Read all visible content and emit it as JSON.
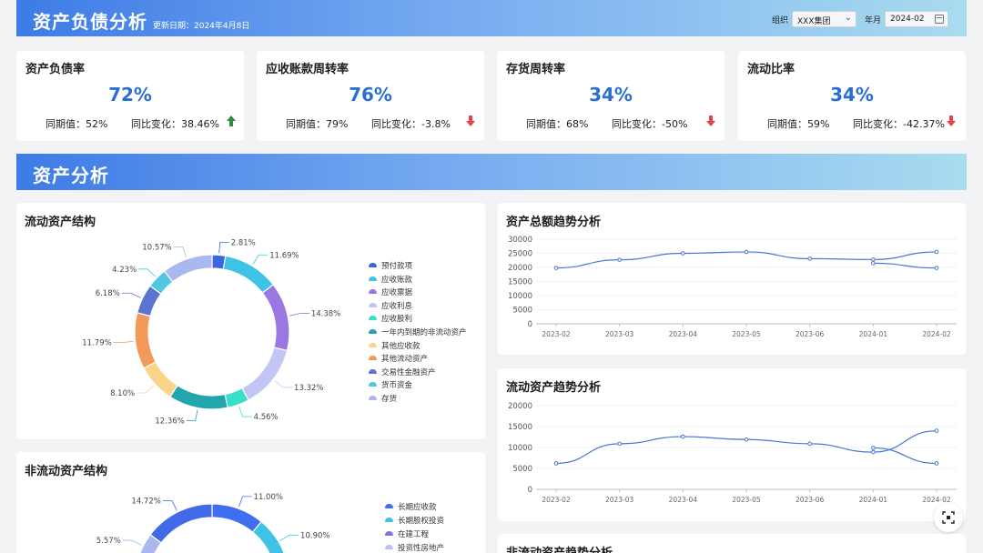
{
  "header": {
    "title": "资产负债分析",
    "update_label": "更新日期：2024年4月8日",
    "filters": {
      "org_label": "组织",
      "org_value": "XXX集团",
      "month_label": "年月",
      "month_value": "2024-02"
    }
  },
  "kpis": [
    {
      "title": "资产负债率",
      "value": "72%",
      "prev": "同期值：52%",
      "yoy": "同比变化：38.46%",
      "trend": "up"
    },
    {
      "title": "应收账款周转率",
      "value": "76%",
      "prev": "同期值：79%",
      "yoy": "同比变化：-3.8%",
      "trend": "down"
    },
    {
      "title": "存货周转率",
      "value": "34%",
      "prev": "同期值：68%",
      "yoy": "同比变化：-50%",
      "trend": "down"
    },
    {
      "title": "流动比率",
      "value": "34%",
      "prev": "同期值：59%",
      "yoy": "同比变化：-42.37%",
      "trend": "down"
    }
  ],
  "section": {
    "title": "资产分析"
  },
  "cards": {
    "current_structure_title": "流动资产结构",
    "noncurrent_structure_title": "非流动资产结构",
    "total_trend_title": "资产总额趋势分析",
    "current_trend_title": "流动资产趋势分析",
    "noncurrent_trend_title": "非流动资产趋势分析"
  },
  "colors": {
    "accent": "#2a6fd6",
    "up": "#2e8b3a",
    "down": "#e0474c",
    "line": "#4a78d0"
  },
  "chart_data": [
    {
      "type": "pie",
      "style": "donut",
      "title": "流动资产结构",
      "series": [
        {
          "name": "预付款项",
          "value": 2.81,
          "label": "2.81%",
          "color": "#3a66e0"
        },
        {
          "name": "应收账款",
          "value": 11.69,
          "label": "11.69%",
          "color": "#3ec3e6"
        },
        {
          "name": "应收票据",
          "value": 14.38,
          "label": "14.38%",
          "color": "#9b77e2"
        },
        {
          "name": "应收利息",
          "value": 13.32,
          "label": "13.32%",
          "color": "#c1c6f5"
        },
        {
          "name": "应收股利",
          "value": 4.56,
          "label": "4.56%",
          "color": "#35e0c6"
        },
        {
          "name": "一年内到期的非流动资产",
          "value": 12.36,
          "label": "12.36%",
          "color": "#21a6ae"
        },
        {
          "name": "其他应收款",
          "value": 8.1,
          "label": "8.10%",
          "color": "#fad48a"
        },
        {
          "name": "其他流动资产",
          "value": 11.79,
          "label": "11.79%",
          "color": "#f29a5a"
        },
        {
          "name": "交易性金融资产",
          "value": 6.18,
          "label": "6.18%",
          "color": "#5a74d2"
        },
        {
          "name": "货币资金",
          "value": 4.23,
          "label": "4.23%",
          "color": "#4ec7df"
        },
        {
          "name": "存货",
          "value": 10.57,
          "label": "10.57%",
          "color": "#a9b9ef"
        }
      ]
    },
    {
      "type": "pie",
      "style": "donut",
      "title": "非流动资产结构",
      "series": [
        {
          "name": "长期应收款",
          "value": 11.0,
          "label": "11.00%",
          "color": "#3f6ef0"
        },
        {
          "name": "长期股权投资",
          "value": 10.9,
          "label": "10.90%",
          "color": "#3ec3e6"
        },
        {
          "name": "在建工程",
          "value": null,
          "label": "",
          "color": "#8a6fe0"
        },
        {
          "name": "投资性房地产",
          "value": null,
          "label": "",
          "color": "#b9c0f5"
        },
        {
          "name": "",
          "value": 5.57,
          "label": "5.57%",
          "color": "#a9b9ef"
        },
        {
          "name": "",
          "value": 14.72,
          "label": "14.72%",
          "color": "#4169e8"
        }
      ]
    },
    {
      "type": "line",
      "title": "资产总额趋势分析",
      "categories": [
        "2023-02",
        "2023-03",
        "2023-04",
        "2023-05",
        "2023-06",
        "2024-01",
        "2024-02"
      ],
      "yticks": [
        0,
        5000,
        10000,
        15000,
        20000,
        25000,
        30000
      ],
      "ylim": [
        0,
        30000
      ],
      "series": [
        {
          "values": [
            19800,
            22700,
            25000,
            25500,
            23100,
            22800,
            25500
          ]
        },
        {
          "values": [
            null,
            null,
            null,
            null,
            null,
            21500,
            19800
          ]
        }
      ]
    },
    {
      "type": "line",
      "title": "流动资产趋势分析",
      "categories": [
        "2023-02",
        "2023-03",
        "2023-04",
        "2023-05",
        "2023-06",
        "2024-01",
        "2024-02"
      ],
      "yticks": [
        0,
        5000,
        10000,
        15000,
        20000
      ],
      "ylim": [
        0,
        20000
      ],
      "series": [
        {
          "values": [
            6200,
            10900,
            12600,
            11900,
            10900,
            8900,
            14000
          ]
        },
        {
          "values": [
            null,
            null,
            null,
            null,
            null,
            9900,
            6200
          ]
        }
      ]
    },
    {
      "type": "line",
      "title": "非流动资产趋势分析"
    }
  ]
}
